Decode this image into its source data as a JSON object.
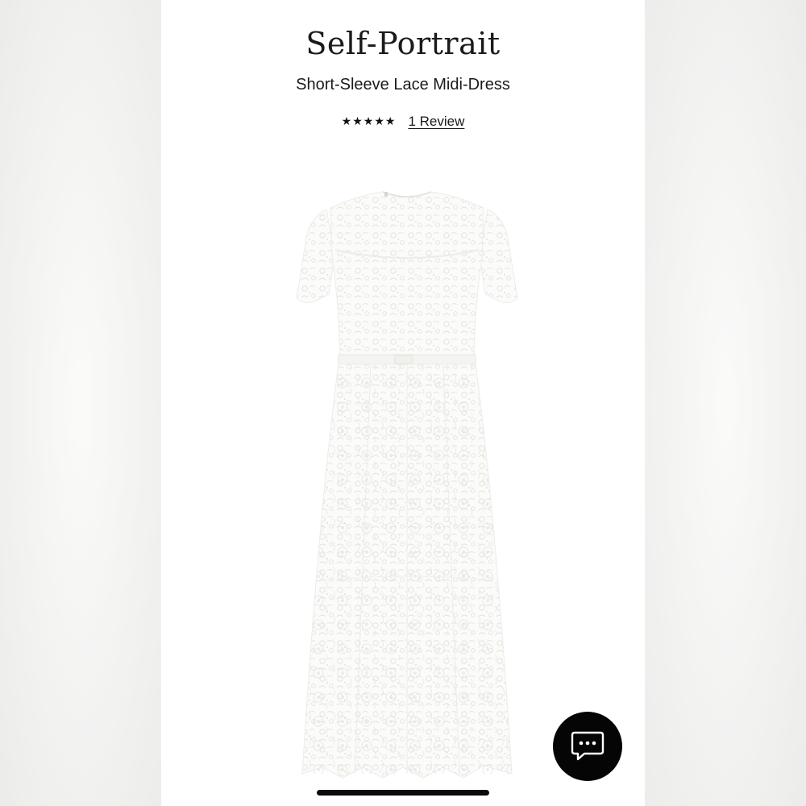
{
  "brand": "Self-Portrait",
  "product": {
    "name": "Short-Sleeve Lace Midi-Dress",
    "rating_stars": 5,
    "star_glyph": "★",
    "review_link": "1 Review"
  },
  "image": {
    "subject": "white lace midi dress",
    "icon": "dress-image"
  },
  "chat": {
    "icon": "chat-bubble-icon"
  },
  "colors": {
    "text": "#1a1a1a",
    "chat_button": "#050505",
    "background": "#ffffff",
    "dress": "#f7f7f5"
  }
}
